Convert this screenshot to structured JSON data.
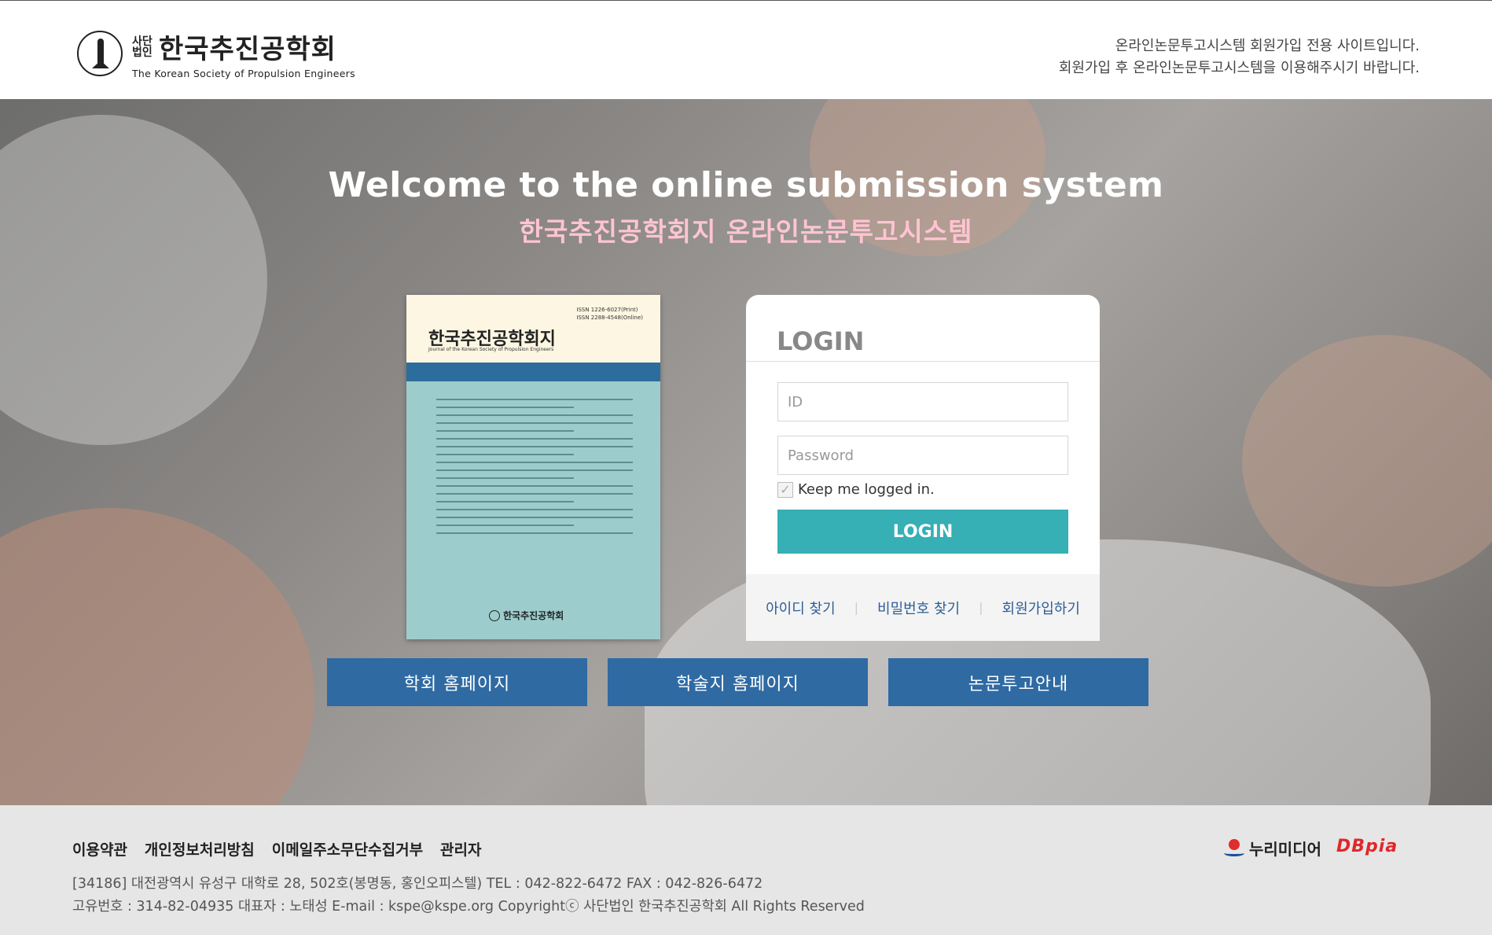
{
  "header": {
    "logo_corp": "사단법인",
    "logo_name": "한국추진공학회",
    "logo_en": "The Korean Society of Propulsion Engineers",
    "msg_line1": "온라인논문투고시스템 회원가입 전용 사이트입니다.",
    "msg_line2": "회원가입 후 온라인논문투고시스템을 이용해주시기 바랍니다."
  },
  "hero": {
    "title": "Welcome to the online submission system",
    "subtitle": "한국추진공학회지 온라인논문투고시스템"
  },
  "cover": {
    "title": "한국추진공학회지",
    "title_en": "Journal of the Korean Society of Propulsion Engineers",
    "issn_print": "ISSN 1226-6027(Print)",
    "issn_online": "ISSN 2288-4548(Online)",
    "publisher": "한국추진공학회"
  },
  "login": {
    "title": "LOGIN",
    "id_placeholder": "ID",
    "password_placeholder": "Password",
    "keep_label": "Keep me logged in.",
    "button_label": "LOGIN",
    "links": {
      "find_id": "아이디 찾기",
      "find_password": "비밀번호 찾기",
      "signup": "회원가입하기"
    }
  },
  "nav_buttons": [
    {
      "label": "학회 홈페이지"
    },
    {
      "label": "학술지 홈페이지"
    },
    {
      "label": "논문투고안내"
    }
  ],
  "footer": {
    "links": [
      "이용약관",
      "개인정보처리방침",
      "이메일주소무단수집거부",
      "관리자"
    ],
    "address_line1": "[34186] 대전광역시 유성구 대학로 28, 502호(봉명동, 홍인오피스텔) TEL : 042-822-6472 FAX : 042-826-6472",
    "address_line2": "고유번호 : 314-82-04935 대표자 : 노태성 E-mail : kspe@kspe.org Copyrightⓒ 사단법인 한국추진공학회 All Rights Reserved",
    "partner1": "누리미디어",
    "partner2": "DBpia"
  },
  "colors": {
    "login_button": "#36afb5",
    "nav_button": "#2f6aa3",
    "subtitle": "#ffc4d2",
    "link": "#2d5e96"
  }
}
